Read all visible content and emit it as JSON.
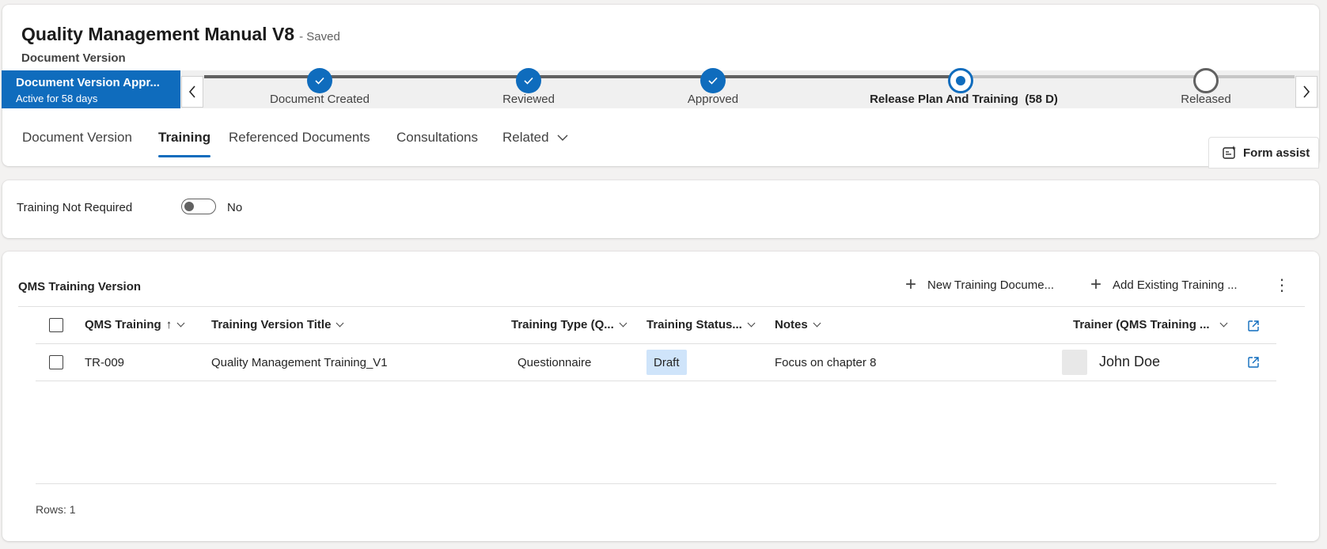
{
  "header": {
    "title": "Quality Management Manual V8",
    "save_status": "- Saved",
    "entity_name": "Document Version"
  },
  "bpf": {
    "active_stage_name": "Document Version Appr...",
    "active_stage_duration": "Active for 58 days",
    "stages": [
      {
        "label": "Document Created",
        "state": "done"
      },
      {
        "label": "Reviewed",
        "state": "done"
      },
      {
        "label": "Approved",
        "state": "done"
      },
      {
        "label": "Release Plan And Training  (58 D)",
        "state": "current"
      },
      {
        "label": "Released",
        "state": "todo"
      }
    ]
  },
  "tabs": [
    {
      "label": "Document Version"
    },
    {
      "label": "Training",
      "selected": true
    },
    {
      "label": "Referenced Documents"
    },
    {
      "label": "Consultations"
    },
    {
      "label": "Related"
    }
  ],
  "form_assist": {
    "label": "Form assist"
  },
  "training_not_required": {
    "label": "Training Not Required",
    "value": "No",
    "on": false
  },
  "grid": {
    "title": "QMS Training Version",
    "commands": {
      "new_label": "New Training Docume...",
      "add_existing_label": "Add Existing Training ..."
    },
    "columns": [
      "QMS Training",
      "Training Version Title",
      "Training Type (Q...",
      "Training Status...",
      "Notes",
      "Trainer (QMS Training ..."
    ],
    "sort_indicator": "↑",
    "rows": [
      {
        "qms_training": "TR-009",
        "title": "Quality Management Training_V1",
        "type": "Questionnaire",
        "status": "Draft",
        "notes": "Focus on chapter 8",
        "trainer": "John Doe"
      }
    ],
    "rows_count_label": "Rows: 1"
  },
  "colors": {
    "accent": "#0f6cbd",
    "status_badge_bg": "#cfe4fa",
    "page_bg": "#f3f2f1"
  }
}
